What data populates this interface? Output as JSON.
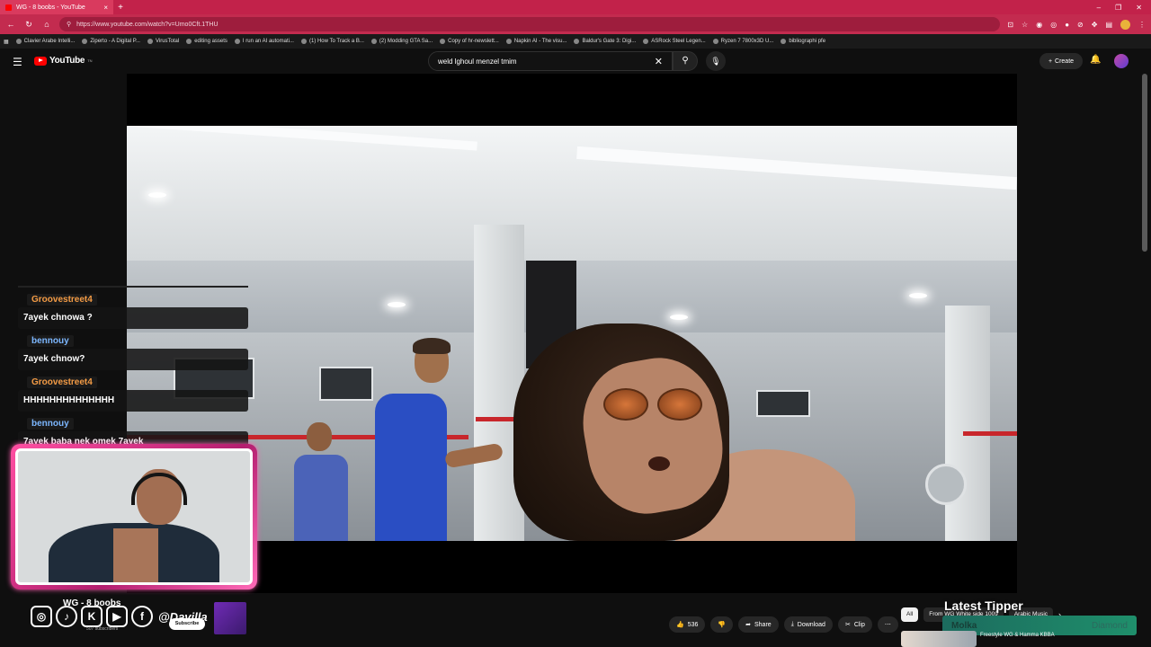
{
  "browser": {
    "tab_title": "WG - 8 boobs - YouTube",
    "url": "https://www.youtube.com/watch?v=Umo0Cft.1THU",
    "bookmarks": [
      "Clavier Arabe Intelli...",
      "Ziperto - A Digital P...",
      "VirusTotal",
      "editing assets",
      "I run an AI automati...",
      "(1) How To Track a B...",
      "(2) Modding GTA Sa...",
      "Copy of hr-newslett...",
      "Napkin AI - The visu...",
      "Baldur's Gate 3: Digi...",
      "ASRock Steel Legen...",
      "Ryzen 7 7800x3D U...",
      "bibliographi pfe"
    ]
  },
  "header": {
    "logo_text": "YouTube",
    "logo_sup": "TN",
    "search_value": "weld  lghoul menzel tmim",
    "create_label": "Create"
  },
  "chat": {
    "messages": [
      {
        "user": "Groovestreet4",
        "text": "7ayek chnowa ?"
      },
      {
        "user": "bennouy",
        "text": "7ayek chnow?"
      },
      {
        "user": "Groovestreet4",
        "text": "HHHHHHHHHHHHHH"
      },
      {
        "user": "bennouy",
        "text": "7ayek baba nek omek 7ayek"
      }
    ]
  },
  "video": {
    "title": "WG - 8 boobs",
    "channel_handle": "@Davilla",
    "subscribers": "507 subscribers",
    "subscribe_label": "Subscribe"
  },
  "actions": {
    "likes": "536",
    "share": "Share",
    "download": "Download",
    "clip": "Clip",
    "more": "⋯"
  },
  "chips": {
    "all": "All",
    "from": "From WG White side 1009",
    "arabic": "Arabic Music"
  },
  "tipper": {
    "heading": "Latest Tipper",
    "name": "Molka",
    "tier": "Diamond"
  },
  "recommendation": {
    "title": "Freestyle WG & Hamma KBBA"
  },
  "colors": {
    "tabbar": "#c2224a",
    "cam_border": "#ff4fa2",
    "yt_red": "#ff0000",
    "tipper_bar": "#1f8f6b"
  }
}
